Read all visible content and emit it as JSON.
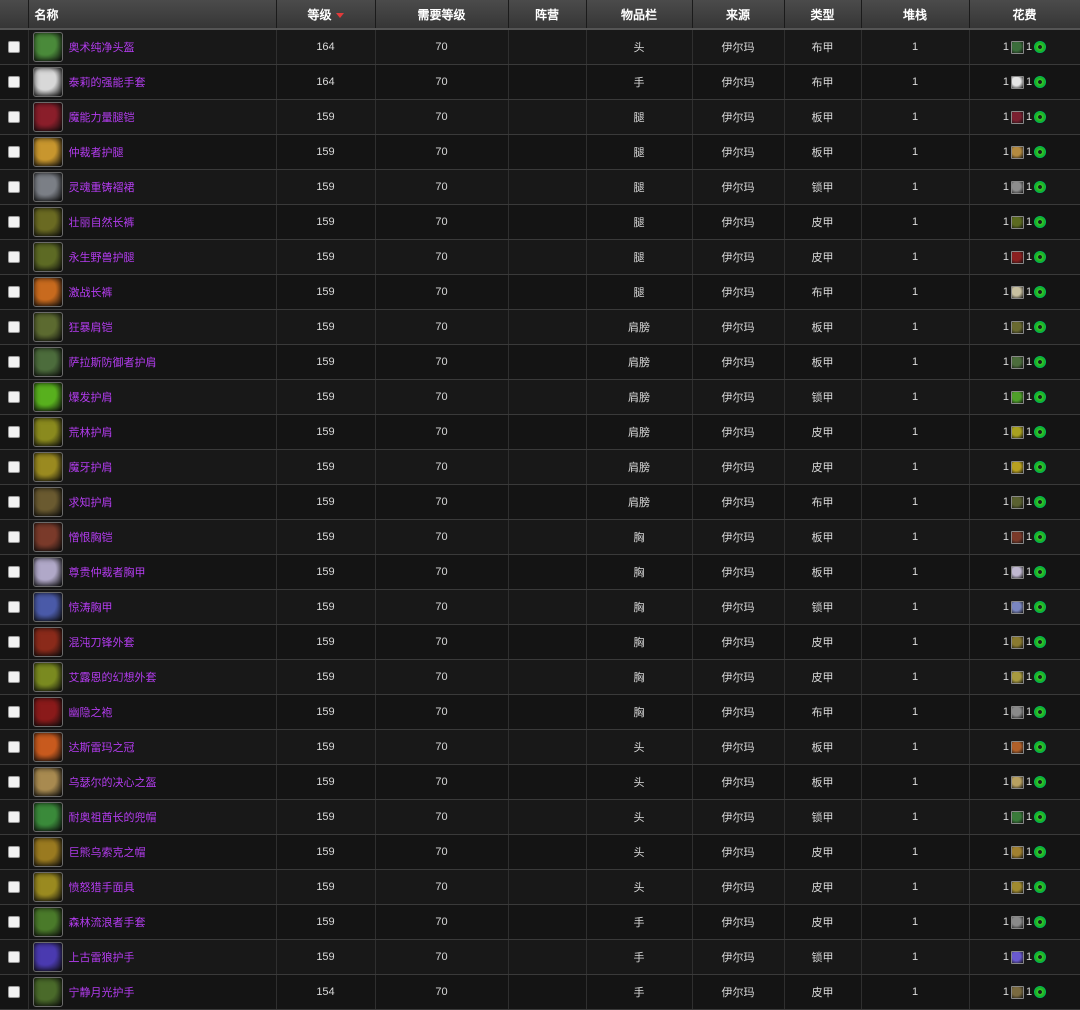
{
  "headers": {
    "name": "名称",
    "level": "等级",
    "req_level": "需要等级",
    "side": "阵营",
    "slot": "物品栏",
    "source": "来源",
    "type": "类型",
    "stack": "堆栈",
    "cost": "花费"
  },
  "rows": [
    {
      "name": "奥术纯净头盔",
      "level": "164",
      "req": "70",
      "side": "",
      "slot": "头",
      "source": "伊尔玛",
      "type": "布甲",
      "stack": "1",
      "cost_a": "1",
      "cost_b": "1",
      "icon_color": "#4a8a3a",
      "mini_color": "#3b6d3b"
    },
    {
      "name": "泰莉的强能手套",
      "level": "164",
      "req": "70",
      "side": "",
      "slot": "手",
      "source": "伊尔玛",
      "type": "布甲",
      "stack": "1",
      "cost_a": "1",
      "cost_b": "1",
      "icon_color": "#d8d8d8",
      "mini_color": "#e5e5e5"
    },
    {
      "name": "魔能力量腿铠",
      "level": "159",
      "req": "70",
      "side": "",
      "slot": "腿",
      "source": "伊尔玛",
      "type": "板甲",
      "stack": "1",
      "cost_a": "1",
      "cost_b": "1",
      "icon_color": "#8a1e2a",
      "mini_color": "#7a2030"
    },
    {
      "name": "仲裁者护腿",
      "level": "159",
      "req": "70",
      "side": "",
      "slot": "腿",
      "source": "伊尔玛",
      "type": "板甲",
      "stack": "1",
      "cost_a": "1",
      "cost_b": "1",
      "icon_color": "#c8962e",
      "mini_color": "#b38a40"
    },
    {
      "name": "灵魂重铸褶裙",
      "level": "159",
      "req": "70",
      "side": "",
      "slot": "腿",
      "source": "伊尔玛",
      "type": "锁甲",
      "stack": "1",
      "cost_a": "1",
      "cost_b": "1",
      "icon_color": "#7b7f86",
      "mini_color": "#8d8d8d"
    },
    {
      "name": "壮丽自然长裤",
      "level": "159",
      "req": "70",
      "side": "",
      "slot": "腿",
      "source": "伊尔玛",
      "type": "皮甲",
      "stack": "1",
      "cost_a": "1",
      "cost_b": "1",
      "icon_color": "#6a6a22",
      "mini_color": "#5c6a20"
    },
    {
      "name": "永生野兽护腿",
      "level": "159",
      "req": "70",
      "side": "",
      "slot": "腿",
      "source": "伊尔玛",
      "type": "皮甲",
      "stack": "1",
      "cost_a": "1",
      "cost_b": "1",
      "icon_color": "#5d6a24",
      "mini_color": "#8a2020"
    },
    {
      "name": "激战长裤",
      "level": "159",
      "req": "70",
      "side": "",
      "slot": "腿",
      "source": "伊尔玛",
      "type": "布甲",
      "stack": "1",
      "cost_a": "1",
      "cost_b": "1",
      "icon_color": "#c86a1e",
      "mini_color": "#c8c0a0"
    },
    {
      "name": "狂暴肩铠",
      "level": "159",
      "req": "70",
      "side": "",
      "slot": "肩膀",
      "source": "伊尔玛",
      "type": "板甲",
      "stack": "1",
      "cost_a": "1",
      "cost_b": "1",
      "icon_color": "#5c6a30",
      "mini_color": "#6a6a30"
    },
    {
      "name": "萨拉斯防御者护肩",
      "level": "159",
      "req": "70",
      "side": "",
      "slot": "肩膀",
      "source": "伊尔玛",
      "type": "板甲",
      "stack": "1",
      "cost_a": "1",
      "cost_b": "1",
      "icon_color": "#4c6c3c",
      "mini_color": "#4c6c3c"
    },
    {
      "name": "爆发护肩",
      "level": "159",
      "req": "70",
      "side": "",
      "slot": "肩膀",
      "source": "伊尔玛",
      "type": "锁甲",
      "stack": "1",
      "cost_a": "1",
      "cost_b": "1",
      "icon_color": "#58b01e",
      "mini_color": "#4f9f2a"
    },
    {
      "name": "荒林护肩",
      "level": "159",
      "req": "70",
      "side": "",
      "slot": "肩膀",
      "source": "伊尔玛",
      "type": "皮甲",
      "stack": "1",
      "cost_a": "1",
      "cost_b": "1",
      "icon_color": "#8a8a1e",
      "mini_color": "#a8a020"
    },
    {
      "name": "魔牙护肩",
      "level": "159",
      "req": "70",
      "side": "",
      "slot": "肩膀",
      "source": "伊尔玛",
      "type": "皮甲",
      "stack": "1",
      "cost_a": "1",
      "cost_b": "1",
      "icon_color": "#9a8a20",
      "mini_color": "#b8a020"
    },
    {
      "name": "求知护肩",
      "level": "159",
      "req": "70",
      "side": "",
      "slot": "肩膀",
      "source": "伊尔玛",
      "type": "布甲",
      "stack": "1",
      "cost_a": "1",
      "cost_b": "1",
      "icon_color": "#6a5a30",
      "mini_color": "#5a6030"
    },
    {
      "name": "憎恨胸铠",
      "level": "159",
      "req": "70",
      "side": "",
      "slot": "胸",
      "source": "伊尔玛",
      "type": "板甲",
      "stack": "1",
      "cost_a": "1",
      "cost_b": "1",
      "icon_color": "#7a3a2a",
      "mini_color": "#7a3a2a"
    },
    {
      "name": "尊贵仲裁者胸甲",
      "level": "159",
      "req": "70",
      "side": "",
      "slot": "胸",
      "source": "伊尔玛",
      "type": "板甲",
      "stack": "1",
      "cost_a": "1",
      "cost_b": "1",
      "icon_color": "#b0a8c8",
      "mini_color": "#c0b8d0"
    },
    {
      "name": "惊涛胸甲",
      "level": "159",
      "req": "70",
      "side": "",
      "slot": "胸",
      "source": "伊尔玛",
      "type": "锁甲",
      "stack": "1",
      "cost_a": "1",
      "cost_b": "1",
      "icon_color": "#4a5aa8",
      "mini_color": "#7a86c0"
    },
    {
      "name": "混沌刀锋外套",
      "level": "159",
      "req": "70",
      "side": "",
      "slot": "胸",
      "source": "伊尔玛",
      "type": "皮甲",
      "stack": "1",
      "cost_a": "1",
      "cost_b": "1",
      "icon_color": "#8a2a1a",
      "mini_color": "#8a7a30"
    },
    {
      "name": "艾露恩的幻想外套",
      "level": "159",
      "req": "70",
      "side": "",
      "slot": "胸",
      "source": "伊尔玛",
      "type": "皮甲",
      "stack": "1",
      "cost_a": "1",
      "cost_b": "1",
      "icon_color": "#7a8a20",
      "mini_color": "#a89a40"
    },
    {
      "name": "幽隐之袍",
      "level": "159",
      "req": "70",
      "side": "",
      "slot": "胸",
      "source": "伊尔玛",
      "type": "布甲",
      "stack": "1",
      "cost_a": "1",
      "cost_b": "1",
      "icon_color": "#8a1a1a",
      "mini_color": "#8a8a8a"
    },
    {
      "name": "达斯雷玛之冠",
      "level": "159",
      "req": "70",
      "side": "",
      "slot": "头",
      "source": "伊尔玛",
      "type": "板甲",
      "stack": "1",
      "cost_a": "1",
      "cost_b": "1",
      "icon_color": "#c85a1e",
      "mini_color": "#b0602a"
    },
    {
      "name": "乌瑟尔的决心之盔",
      "level": "159",
      "req": "70",
      "side": "",
      "slot": "头",
      "source": "伊尔玛",
      "type": "板甲",
      "stack": "1",
      "cost_a": "1",
      "cost_b": "1",
      "icon_color": "#a88a50",
      "mini_color": "#b8a060"
    },
    {
      "name": "耐奥祖酋长的兜帽",
      "level": "159",
      "req": "70",
      "side": "",
      "slot": "头",
      "source": "伊尔玛",
      "type": "锁甲",
      "stack": "1",
      "cost_a": "1",
      "cost_b": "1",
      "icon_color": "#3a8a3a",
      "mini_color": "#3a7a3a"
    },
    {
      "name": "巨熊乌索克之帽",
      "level": "159",
      "req": "70",
      "side": "",
      "slot": "头",
      "source": "伊尔玛",
      "type": "皮甲",
      "stack": "1",
      "cost_a": "1",
      "cost_b": "1",
      "icon_color": "#9a7a20",
      "mini_color": "#a08030"
    },
    {
      "name": "愤怒猎手面具",
      "level": "159",
      "req": "70",
      "side": "",
      "slot": "头",
      "source": "伊尔玛",
      "type": "皮甲",
      "stack": "1",
      "cost_a": "1",
      "cost_b": "1",
      "icon_color": "#9a8a20",
      "mini_color": "#a08a30"
    },
    {
      "name": "森林流浪者手套",
      "level": "159",
      "req": "70",
      "side": "",
      "slot": "手",
      "source": "伊尔玛",
      "type": "皮甲",
      "stack": "1",
      "cost_a": "1",
      "cost_b": "1",
      "icon_color": "#4a7a2a",
      "mini_color": "#8a8a8a"
    },
    {
      "name": "上古雷狼护手",
      "level": "159",
      "req": "70",
      "side": "",
      "slot": "手",
      "source": "伊尔玛",
      "type": "锁甲",
      "stack": "1",
      "cost_a": "1",
      "cost_b": "1",
      "icon_color": "#4a3ab0",
      "mini_color": "#6a5ad0"
    },
    {
      "name": "宁静月光护手",
      "level": "154",
      "req": "70",
      "side": "",
      "slot": "手",
      "source": "伊尔玛",
      "type": "皮甲",
      "stack": "1",
      "cost_a": "1",
      "cost_b": "1",
      "icon_color": "#4a6a2a",
      "mini_color": "#7a6a40"
    }
  ]
}
